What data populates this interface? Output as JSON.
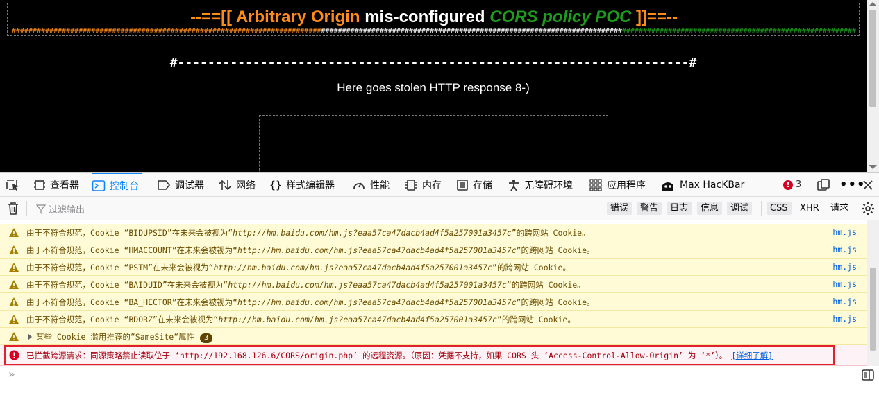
{
  "page": {
    "title_parts": [
      {
        "text": "--==[[ Arbitrary Origin ",
        "color": "orange"
      },
      {
        "text": "mis-configured ",
        "color": "white"
      },
      {
        "text": "CORS policy POC ",
        "color": "green"
      },
      {
        "text": "]]==--",
        "color": "orange"
      }
    ],
    "hash_orange": "##########################################################################",
    "hash_white": "########################################################################",
    "hash_green": "############################################################################",
    "divider": "#--------------------------------------------------------------------#",
    "stolen_text": "Here goes stolen HTTP response 8-)"
  },
  "devtools": {
    "tabs": [
      {
        "label": "查看器",
        "icon": "inspector-icon"
      },
      {
        "label": "控制台",
        "icon": "console-icon",
        "active": true
      },
      {
        "label": "调试器",
        "icon": "debugger-icon"
      },
      {
        "label": "网络",
        "icon": "network-icon"
      },
      {
        "label": "样式编辑器",
        "icon": "style-editor-icon"
      },
      {
        "label": "性能",
        "icon": "performance-icon"
      },
      {
        "label": "内存",
        "icon": "memory-icon"
      },
      {
        "label": "存储",
        "icon": "storage-icon"
      },
      {
        "label": "无障碍环境",
        "icon": "accessibility-icon"
      },
      {
        "label": "应用程序",
        "icon": "application-icon"
      },
      {
        "label": "Max HacKBar",
        "icon": "hackbar-icon"
      }
    ],
    "error_count": "3",
    "filter_placeholder": "过滤输出",
    "levels": [
      "错误",
      "警告",
      "日志",
      "信息",
      "调试"
    ],
    "extra_filters": [
      "CSS",
      "XHR",
      "请求"
    ],
    "accent": "#0a84ff"
  },
  "console": {
    "warnings": [
      {
        "prefix": "由于不符合规范，Cookie “BIDUPSID”在未来会被视为“",
        "url": "http://hm.baidu.com/hm.js?eaa57ca47dacb4ad4f5a257001a3457c",
        "suffix": "”的跨网站 Cookie。",
        "source": "hm.js"
      },
      {
        "prefix": "由于不符合规范，Cookie “HMACCOUNT”在未来会被视为“",
        "url": "http://hm.baidu.com/hm.js?eaa57ca47dacb4ad4f5a257001a3457c",
        "suffix": "”的跨网站 Cookie。",
        "source": "hm.js"
      },
      {
        "prefix": "由于不符合规范，Cookie “PSTM”在未来会被视为“",
        "url": "http://hm.baidu.com/hm.js?eaa57ca47dacb4ad4f5a257001a3457c",
        "suffix": "”的跨网站 Cookie。",
        "source": "hm.js"
      },
      {
        "prefix": "由于不符合规范，Cookie “BAIDUID”在未来会被视为“",
        "url": "http://hm.baidu.com/hm.js?eaa57ca47dacb4ad4f5a257001a3457c",
        "suffix": "”的跨网站 Cookie。",
        "source": "hm.js"
      },
      {
        "prefix": "由于不符合规范，Cookie “BA_HECTOR”在未来会被视为“",
        "url": "http://hm.baidu.com/hm.js?eaa57ca47dacb4ad4f5a257001a3457c",
        "suffix": "”的跨网站 Cookie。",
        "source": "hm.js"
      },
      {
        "prefix": "由于不符合规范，Cookie “BDORZ”在未来会被视为“",
        "url": "http://hm.baidu.com/hm.js?eaa57ca47dacb4ad4f5a257001a3457c",
        "suffix": "”的跨网站 Cookie。",
        "source": "hm.js"
      }
    ],
    "group": {
      "text": "某些 Cookie 滥用推荐的“SameSite“属性",
      "count": "3"
    },
    "error": {
      "text": "已拦截跨源请求：同源策略禁止读取位于 ‘http://192.168.126.6/CORS/origin.php’ 的远程资源。（原因：凭据不支持，如果 CORS 头 ‘Access-Control-Allow-Origin’ 为 ‘*’）。",
      "link": "[详细了解]"
    },
    "prompt_glyph": "»"
  }
}
